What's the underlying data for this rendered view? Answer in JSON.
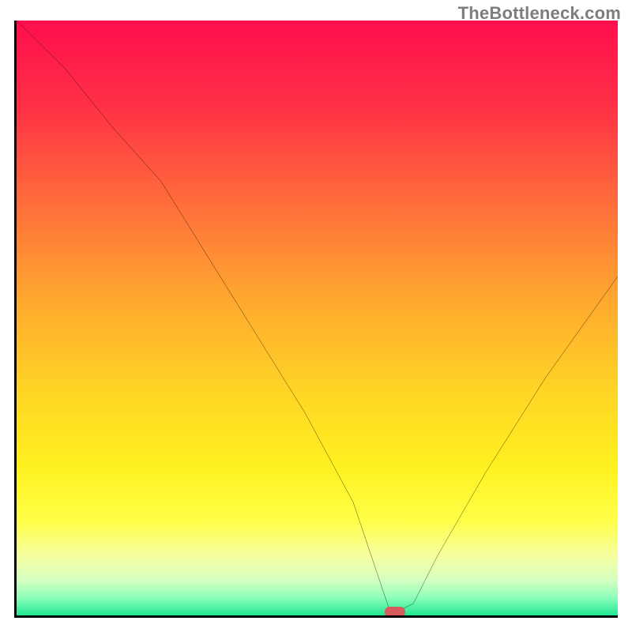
{
  "watermark": "TheBottleneck.com",
  "accent_marker_color": "#d55b5d",
  "chart_data": {
    "type": "line",
    "title": "",
    "xlabel": "",
    "ylabel": "",
    "xlim": [
      0,
      100
    ],
    "ylim": [
      0,
      100
    ],
    "grid": false,
    "annotations": [
      "V-shaped bottleneck curve over rainbow gradient; minimum ≈ x 63"
    ],
    "series": [
      {
        "name": "bottleneck-curve",
        "x": [
          0,
          8,
          16,
          24,
          32,
          40,
          48,
          56,
          60,
          62,
          64,
          66,
          70,
          78,
          88,
          100
        ],
        "y": [
          100,
          92,
          82,
          73,
          60,
          47,
          34,
          19,
          7,
          1,
          1,
          2,
          10,
          24,
          40,
          57
        ]
      }
    ],
    "minimum": {
      "x": 63,
      "y": 0.6,
      "width_pct": 3.4,
      "height_pct": 1.6
    },
    "background_gradient_stops": [
      {
        "pct": 0,
        "color": "#ff0e4e"
      },
      {
        "pct": 14,
        "color": "#ff2f46"
      },
      {
        "pct": 30,
        "color": "#ff6a3b"
      },
      {
        "pct": 46,
        "color": "#ffa52f"
      },
      {
        "pct": 62,
        "color": "#ffd425"
      },
      {
        "pct": 75,
        "color": "#fff11f"
      },
      {
        "pct": 84,
        "color": "#ffff47"
      },
      {
        "pct": 90,
        "color": "#f6ffa0"
      },
      {
        "pct": 94,
        "color": "#d6ffc0"
      },
      {
        "pct": 97,
        "color": "#8effba"
      },
      {
        "pct": 100,
        "color": "#1fe692"
      }
    ]
  }
}
